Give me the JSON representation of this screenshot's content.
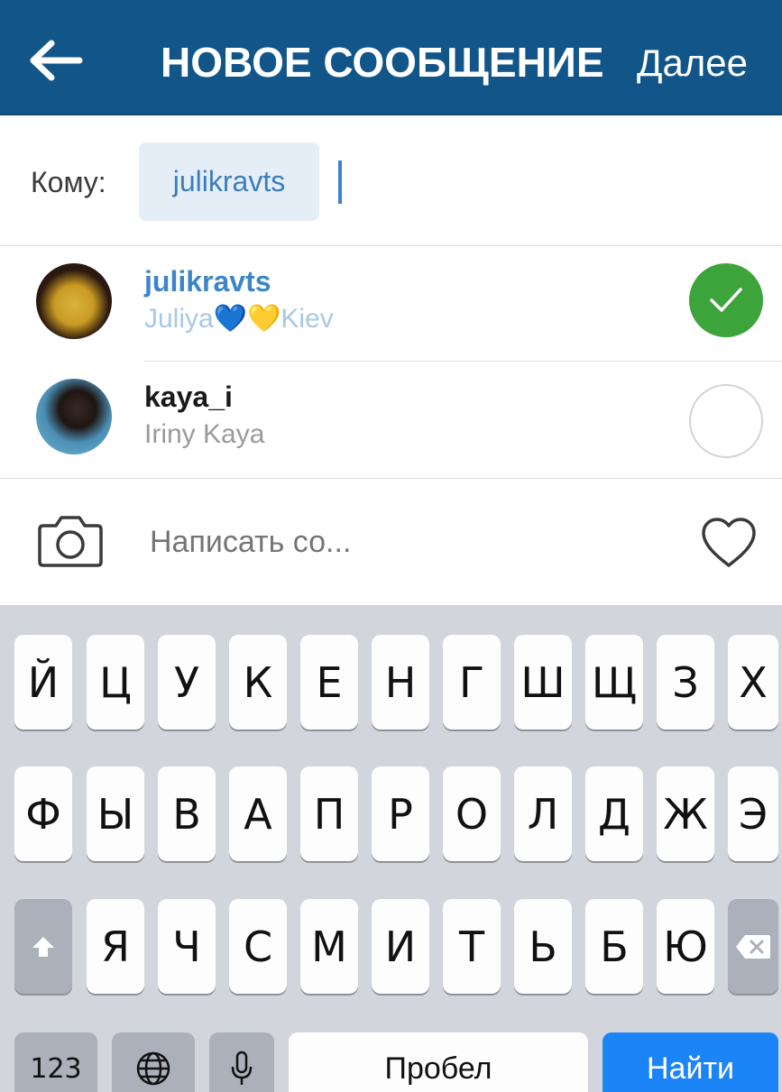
{
  "header": {
    "title": "НОВОЕ СООБЩЕНИЕ",
    "next_label": "Далее"
  },
  "recipient": {
    "label": "Кому:",
    "chip": "julikravts"
  },
  "users": [
    {
      "username": "julikravts",
      "subtitle": "Juliya💙💛Kiev",
      "selected": true
    },
    {
      "username": "kaya_i",
      "subtitle": "Iriny Kaya",
      "selected": false
    }
  ],
  "compose": {
    "placeholder": "Написать со..."
  },
  "keyboard": {
    "row1": [
      "Й",
      "Ц",
      "У",
      "К",
      "Е",
      "Н",
      "Г",
      "Ш",
      "Щ",
      "З",
      "Х"
    ],
    "row2": [
      "Ф",
      "Ы",
      "В",
      "А",
      "П",
      "Р",
      "О",
      "Л",
      "Д",
      "Ж",
      "Э"
    ],
    "row3": [
      "Я",
      "Ч",
      "С",
      "М",
      "И",
      "Т",
      "Ь",
      "Б",
      "Ю"
    ],
    "numbers_key": "123",
    "space_key": "Пробел",
    "search_key": "Найти"
  },
  "colors": {
    "header_bg": "#125689",
    "accent_blue": "#3c86c8",
    "check_green": "#3da33b",
    "search_key": "#1b84f6"
  },
  "icons": {
    "back": "arrow-left-icon",
    "selected": "checkmark-icon",
    "camera": "camera-icon",
    "like": "heart-icon",
    "shift": "shift-icon",
    "backspace": "backspace-icon",
    "globe": "globe-icon",
    "mic": "microphone-icon"
  }
}
